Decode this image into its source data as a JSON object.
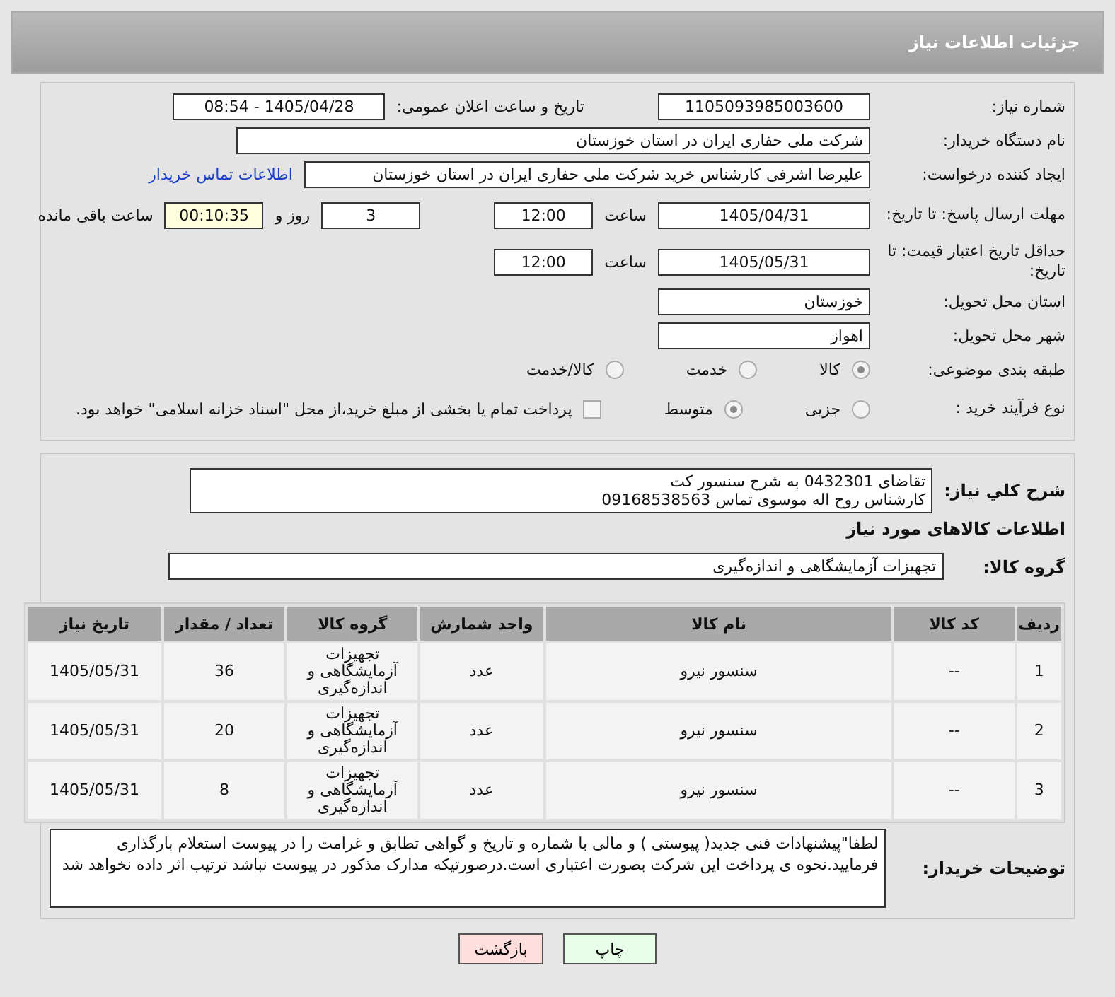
{
  "header": {
    "title": "جزئیات اطلاعات نیاز"
  },
  "need_number": {
    "label": "شماره نیاز:",
    "value": "1105093985003600"
  },
  "announce": {
    "label": "تاریخ و ساعت اعلان عمومی:",
    "value": "1405/04/28 - 08:54"
  },
  "buyer_org": {
    "label": "نام دستگاه خریدار:",
    "value": "شرکت ملی حفاری ایران در استان خوزستان"
  },
  "requester": {
    "label": "ایجاد کننده درخواست:",
    "value": "علیرضا اشرفی کارشناس خرید شرکت ملی حفاری ایران در استان خوزستان",
    "link": "اطلاعات تماس خریدار"
  },
  "reply_deadline": {
    "label": "مهلت ارسال پاسخ: تا تاریخ:",
    "date": "1405/04/31",
    "time_label": "ساعت",
    "time": "12:00",
    "days": "3",
    "days_label": "روز و",
    "remaining": "00:10:35",
    "remaining_label": "ساعت باقی مانده"
  },
  "price_validity": {
    "label": "حداقل تاریخ اعتبار قیمت: تا تاریخ:",
    "date": "1405/05/31",
    "time_label": "ساعت",
    "time": "12:00"
  },
  "province": {
    "label": "استان محل تحویل:",
    "value": "خوزستان"
  },
  "city": {
    "label": "شهر محل تحویل:",
    "value": "اهواز"
  },
  "category": {
    "label": "طبقه بندی موضوعی:",
    "options": [
      {
        "label": "کالا",
        "selected": true
      },
      {
        "label": "خدمت",
        "selected": false
      },
      {
        "label": "کالا/خدمت",
        "selected": false
      }
    ]
  },
  "process": {
    "label": "نوع فرآیند خرید :",
    "options": [
      {
        "label": "جزیی",
        "selected": false
      },
      {
        "label": "متوسط",
        "selected": true
      }
    ],
    "treasury": {
      "label": "پرداخت تمام یا بخشی از مبلغ خرید،از محل \"اسناد خزانه اسلامی\" خواهد بود.",
      "checked": false
    }
  },
  "description": {
    "label": "شرح كلي نیاز:",
    "value": "تقاضای 0432301 به شرح سنسور کت\nکارشناس روح اله موسوی تماس 09168538563"
  },
  "goods_heading": "اطلاعات کالاهای مورد نیاز",
  "goods_group": {
    "label": "گروه کالا:",
    "value": "تجهیزات آزمایشگاهی و اندازه‌گیری"
  },
  "table": {
    "columns": [
      "ردیف",
      "کد کالا",
      "نام کالا",
      "واحد شمارش",
      "گروه کالا",
      "تعداد / مقدار",
      "تاریخ نیاز"
    ],
    "rows": [
      [
        "1",
        "--",
        "سنسور نیرو",
        "عدد",
        "تجهیزات آزمایشگاهی و اندازه‌گیری",
        "36",
        "1405/05/31"
      ],
      [
        "2",
        "--",
        "سنسور نیرو",
        "عدد",
        "تجهیزات آزمایشگاهی و اندازه‌گیری",
        "20",
        "1405/05/31"
      ],
      [
        "3",
        "--",
        "سنسور نیرو",
        "عدد",
        "تجهیزات آزمایشگاهی و اندازه‌گیری",
        "8",
        "1405/05/31"
      ]
    ]
  },
  "buyer_notes": {
    "label": "توضیحات خریدار:",
    "value": "لطفا\"پیشنهادات فنی جدید( پیوستی ) و مالی با شماره و تاریخ و گواهی تطابق و غرامت را در پیوست استعلام بارگذاری فرمایید.نحوه ی پرداخت این شرکت بصورت اعتباری است.درصورتیکه مدارک مذکور در پیوست نباشد ترتیب اثر داده نخواهد شد"
  },
  "buttons": [
    {
      "label": "چاپ",
      "kind": "print"
    },
    {
      "label": "بازگشت",
      "kind": "back"
    }
  ]
}
